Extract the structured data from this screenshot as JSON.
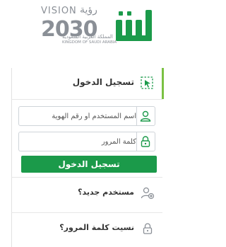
{
  "header": {
    "vision_en": "VISION",
    "vision_ar": "رؤية",
    "year": "2030",
    "kingdom_ar": "المملكة العربية السعودية",
    "kingdom_en": "KINGDOM OF SAUDI ARABIA"
  },
  "login": {
    "title": "تسجيل الدخول",
    "username_placeholder": "اسم المستخدم أو رقم الهوية",
    "password_placeholder": "كلمة المرور",
    "submit_label": "تسجيل الدخول"
  },
  "links": {
    "new_user": "مستخدم جديد؟",
    "forgot_password": "نسيت كلمة المرور؟"
  },
  "colors": {
    "brand_green": "#1b9a4a",
    "accent_light_green": "#7ac143",
    "gray": "#8a8f96"
  }
}
